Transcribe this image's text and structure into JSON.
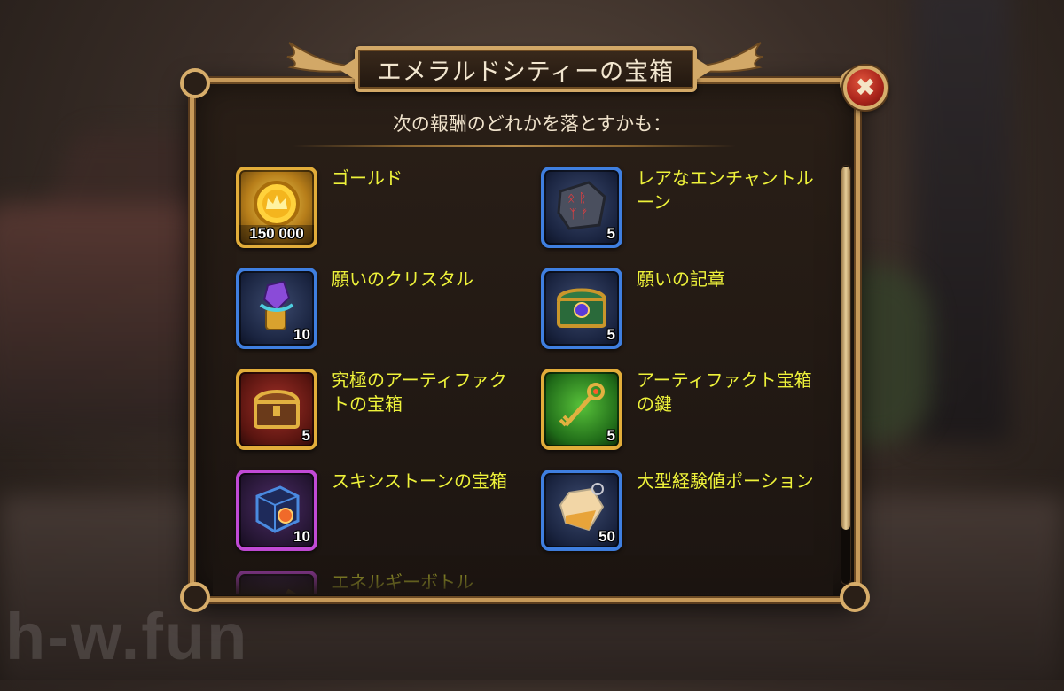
{
  "dialog": {
    "title": "エメラルドシティーの宝箱",
    "subtitle": "次の報酬のどれかを落とすかも：",
    "close_symbol": "✖"
  },
  "rewards": [
    {
      "name": "ゴールド",
      "quantity": "150 000",
      "rarity": "gold",
      "icon": "gold-coin-icon"
    },
    {
      "name": "レアなエンチャントルーン",
      "quantity": "5",
      "rarity": "blue",
      "icon": "rune-stone-icon"
    },
    {
      "name": "願いのクリスタル",
      "quantity": "10",
      "rarity": "blue",
      "icon": "crystal-icon"
    },
    {
      "name": "願いの記章",
      "quantity": "5",
      "rarity": "blue",
      "icon": "emblem-chest-icon"
    },
    {
      "name": "究極のアーティファクトの宝箱",
      "quantity": "5",
      "rarity": "gold",
      "icon": "artifact-chest-icon"
    },
    {
      "name": "アーティファクト宝箱の鍵",
      "quantity": "5",
      "rarity": "gold",
      "icon": "artifact-key-icon"
    },
    {
      "name": "スキンストーンの宝箱",
      "quantity": "10",
      "rarity": "purple",
      "icon": "skin-stone-chest-icon"
    },
    {
      "name": "大型経験値ポーション",
      "quantity": "50",
      "rarity": "blue",
      "icon": "xp-potion-icon"
    },
    {
      "name": "エネルギーボトル",
      "quantity": "",
      "rarity": "purple",
      "icon": "energy-bottle-icon"
    }
  ],
  "watermark": "h-w.fun",
  "scroll": {
    "position_fraction": 0.0
  }
}
